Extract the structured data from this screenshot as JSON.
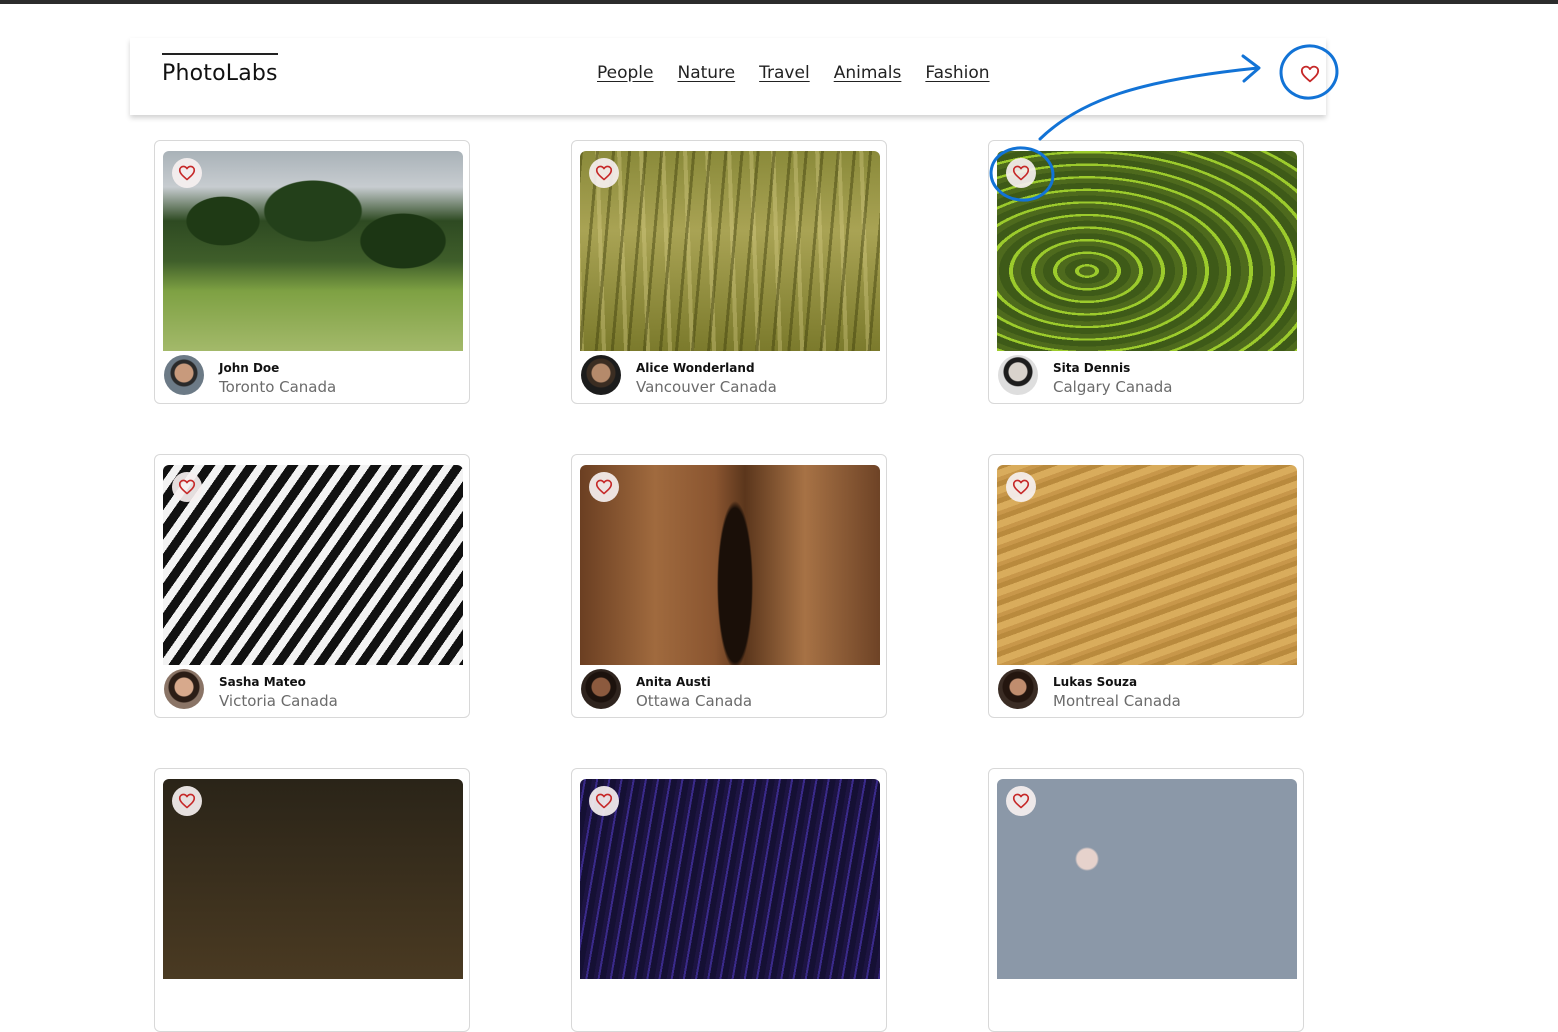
{
  "app": {
    "logo": "PhotoLabs"
  },
  "nav": {
    "topics": [
      "People",
      "Nature",
      "Travel",
      "Animals",
      "Fashion"
    ],
    "favourites_icon": "heart-icon"
  },
  "photos": [
    {
      "user": "John Doe",
      "location": "Toronto Canada",
      "image": "horses grazing on hillside",
      "liked": false
    },
    {
      "user": "Alice Wonderland",
      "location": "Vancouver Canada",
      "image": "bird perched in reeds",
      "liked": false
    },
    {
      "user": "Sita Dennis",
      "location": "Calgary Canada",
      "image": "aerial rice terraces",
      "liked": false
    },
    {
      "user": "Sasha Mateo",
      "location": "Victoria Canada",
      "image": "zebra stripes close-up",
      "liked": false
    },
    {
      "user": "Anita Austi",
      "location": "Ottawa Canada",
      "image": "desert canyon cliffs",
      "liked": false
    },
    {
      "user": "Lukas Souza",
      "location": "Montreal Canada",
      "image": "sand dune ripples",
      "liked": false
    }
  ],
  "colors": {
    "heart": "#c62828",
    "annotation": "#1273d6",
    "location_text": "#6b6b6b"
  }
}
